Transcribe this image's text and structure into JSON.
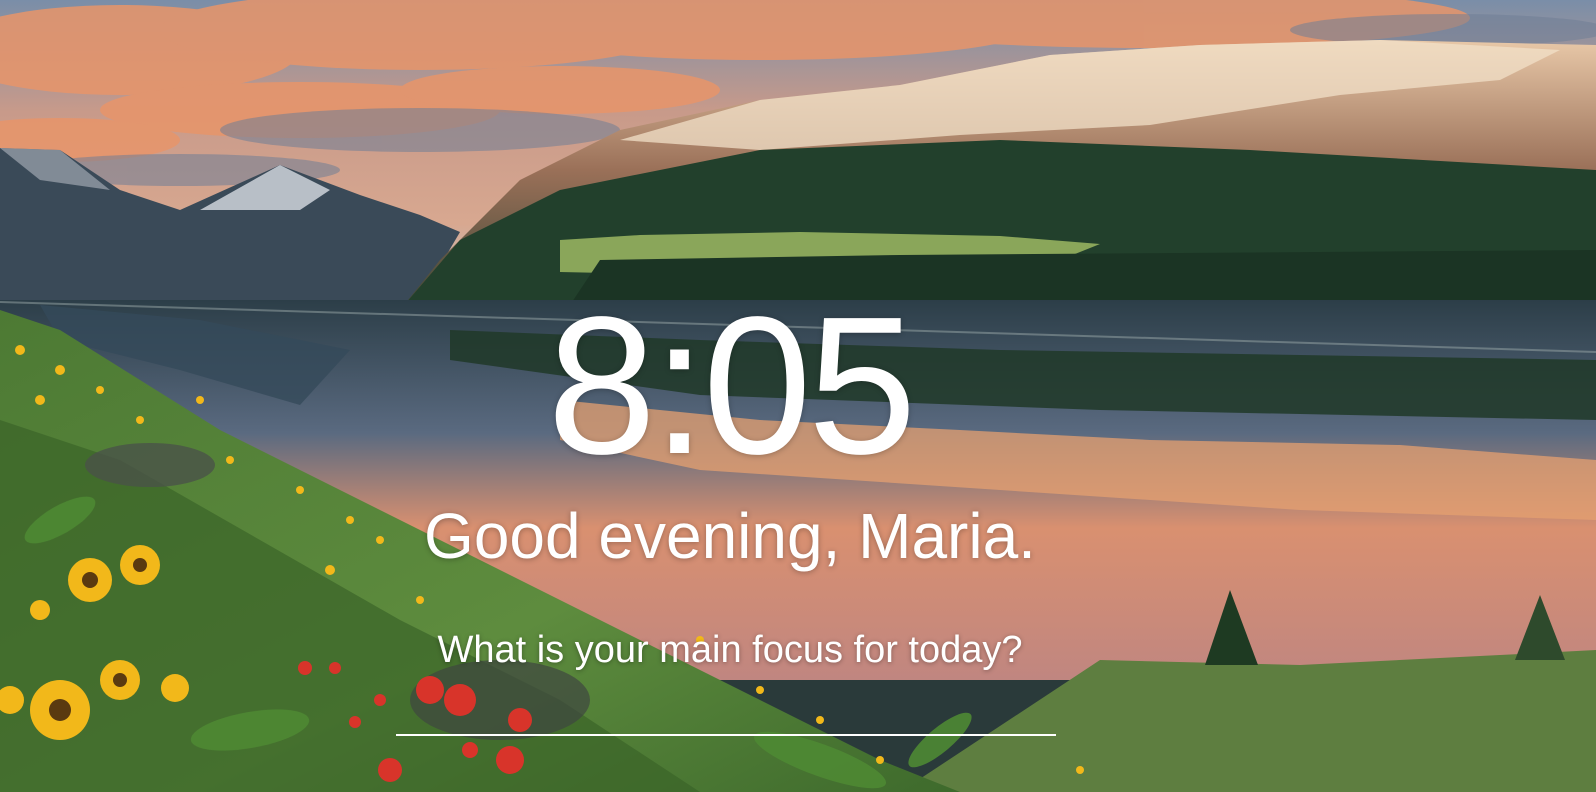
{
  "clock": {
    "time": "8:05"
  },
  "greeting": {
    "text": "Good evening, Maria."
  },
  "focus": {
    "question": "What is your main focus for today?",
    "input_value": "",
    "placeholder": ""
  },
  "background": {
    "subject": "mountain-lake-sunset-wildflowers",
    "sky_color": "#8aa4b8",
    "cloud_color": "#e8956a",
    "water_reflection_color": "#d9886a",
    "forest_color": "#1f3a28",
    "meadow_color": "#5f8a3c",
    "flower_yellow": "#f2b81a",
    "flower_red": "#d8342a"
  }
}
